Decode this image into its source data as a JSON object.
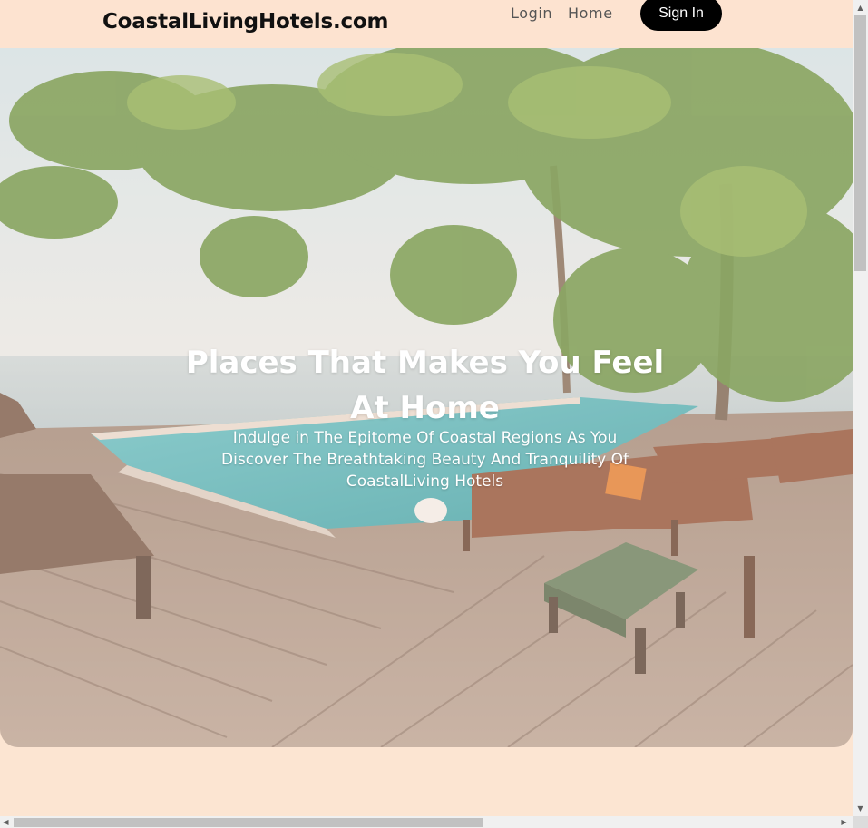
{
  "header": {
    "brand": "CoastalLivingHotels.com",
    "nav": {
      "login": "Login",
      "home": "Home",
      "signin": "Sign In"
    }
  },
  "hero": {
    "title": "Places That Makes You Feel At Home",
    "subtitle": "Indulge in The Epitome Of Coastal Regions As You Discover The Breathtaking Beauty And Tranquility Of CoastalLiving Hotels"
  },
  "scrollbars": {
    "up_icon": "triangle-up",
    "down_icon": "triangle-down",
    "left_icon": "triangle-left",
    "right_icon": "triangle-right"
  },
  "colors": {
    "page_bg": "#fce5d2",
    "button_bg": "#000000",
    "button_text": "#ffffff"
  }
}
